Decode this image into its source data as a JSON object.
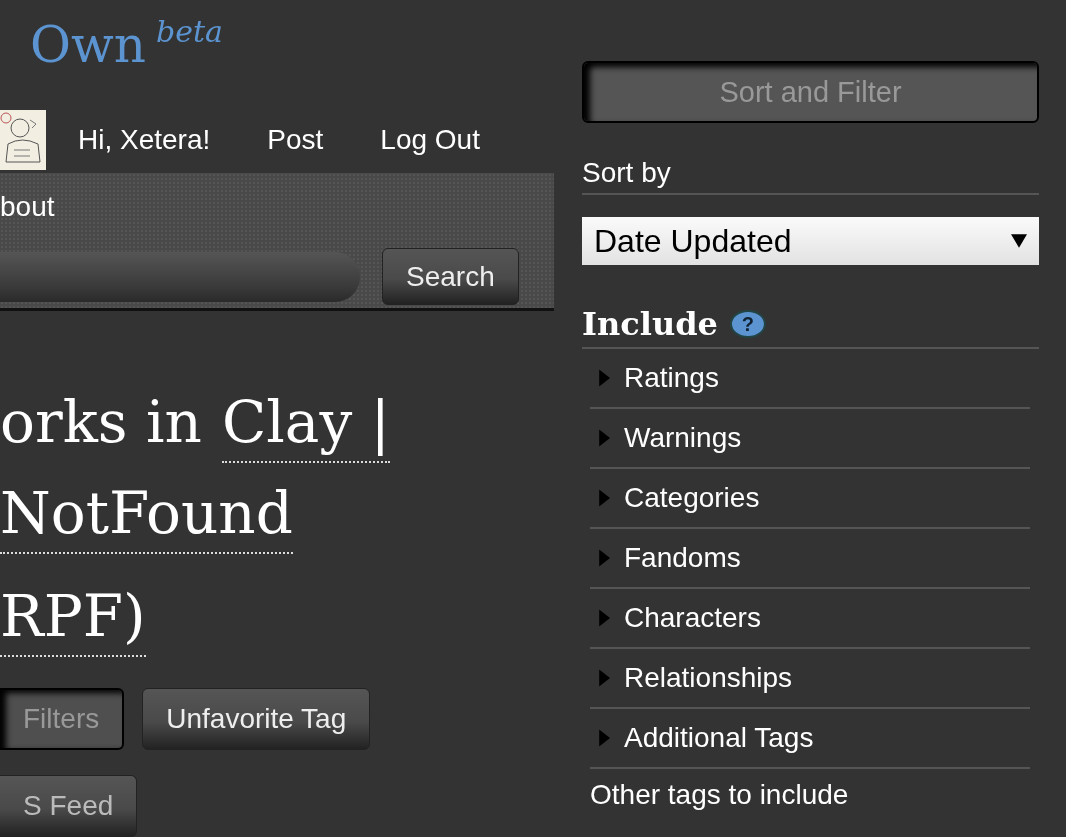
{
  "logo": {
    "text": "Own",
    "superscript": "beta"
  },
  "user_nav": {
    "greeting": "Hi, Xetera!",
    "links": [
      "Post",
      "Log Out"
    ]
  },
  "primary_nav": {
    "items": [
      "bout"
    ]
  },
  "search": {
    "button": "Search"
  },
  "heading": {
    "lines": [
      {
        "plain": "orks in",
        "link": "Clay |"
      },
      {
        "link": "NotFound"
      },
      {
        "link": "RPF)"
      }
    ]
  },
  "actions": [
    {
      "label": "Filters",
      "selected": true
    },
    {
      "label": "Unfavorite Tag",
      "selected": false
    }
  ],
  "actions_row2": [
    {
      "label": "S Feed",
      "selected": false
    }
  ],
  "sidebar": {
    "toggle": "Sort and Filter",
    "sort_label": "Sort by",
    "sort_value": "Date Updated",
    "include_title": "Include",
    "help": "?",
    "include_items": [
      {
        "label": "Ratings",
        "expanded": false
      },
      {
        "label": "Warnings",
        "expanded": false
      },
      {
        "label": "Categories",
        "expanded": false
      },
      {
        "label": "Fandoms",
        "expanded": false
      },
      {
        "label": "Characters",
        "expanded": false
      },
      {
        "label": "Relationships",
        "expanded": false
      },
      {
        "label": "Additional Tags",
        "expanded": false
      }
    ],
    "other_label": "Other tags to include"
  }
}
